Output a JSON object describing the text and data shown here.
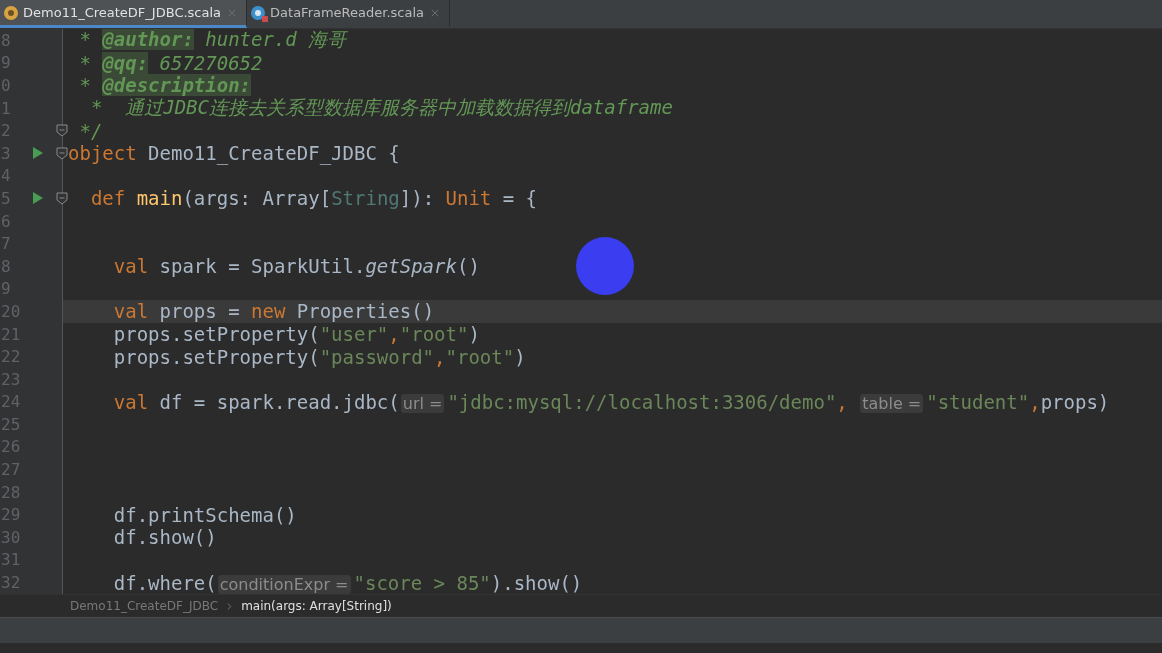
{
  "tabs": [
    {
      "label": "Demo11_CreateDF_JDBC.scala",
      "kind": "object",
      "selected": true
    },
    {
      "label": "DataFrameReader.scala",
      "kind": "class",
      "selected": false
    }
  ],
  "editor": {
    "lines": [
      {
        "number": "8",
        "run": false,
        "fold": false,
        "current": false,
        "segments": [
          {
            "kind": "comment",
            "text": " * "
          },
          {
            "kind": "doctag",
            "text": "@author:"
          },
          {
            "kind": "comment",
            "text": " hunter.d 海哥"
          }
        ]
      },
      {
        "number": "9",
        "run": false,
        "fold": false,
        "current": false,
        "segments": [
          {
            "kind": "comment",
            "text": " * "
          },
          {
            "kind": "doctag",
            "text": "@qq:"
          },
          {
            "kind": "comment",
            "text": " 657270652"
          }
        ]
      },
      {
        "number": "0",
        "run": false,
        "fold": false,
        "current": false,
        "segments": [
          {
            "kind": "comment",
            "text": " * "
          },
          {
            "kind": "doctag",
            "text": "@description:"
          }
        ]
      },
      {
        "number": "1",
        "run": false,
        "fold": false,
        "current": false,
        "segments": [
          {
            "kind": "comment",
            "text": "  *  通过JDBC连接去关系型数据库服务器中加载数据得到dataframe"
          }
        ]
      },
      {
        "number": "2",
        "run": false,
        "fold": true,
        "current": false,
        "segments": [
          {
            "kind": "comment",
            "text": " */"
          }
        ]
      },
      {
        "number": "3",
        "run": true,
        "fold": true,
        "current": false,
        "segments": [
          {
            "kind": "keyword",
            "text": "object "
          },
          {
            "kind": "plain",
            "text": "Demo11_CreateDF_JDBC {"
          }
        ]
      },
      {
        "number": "4",
        "run": false,
        "fold": false,
        "current": false
      },
      {
        "number": "5",
        "run": true,
        "fold": true,
        "current": false,
        "segments": [
          {
            "kind": "keyword",
            "text": "  def "
          },
          {
            "kind": "method",
            "text": "main"
          },
          {
            "kind": "plain",
            "text": "(args: Array["
          },
          {
            "kind": "typeparam",
            "text": "String"
          },
          {
            "kind": "plain",
            "text": "]): "
          },
          {
            "kind": "keyword",
            "text": "Unit"
          },
          {
            "kind": "plain",
            "text": " = {"
          }
        ]
      },
      {
        "number": "6",
        "run": false,
        "fold": false,
        "current": false
      },
      {
        "number": "7",
        "run": false,
        "fold": false,
        "current": false
      },
      {
        "number": "8",
        "run": false,
        "fold": false,
        "current": false,
        "segments": [
          {
            "kind": "keyword",
            "text": "    val "
          },
          {
            "kind": "plain",
            "text": "spark = SparkUtil."
          },
          {
            "kind": "italic",
            "text": "getSpark"
          },
          {
            "kind": "plain",
            "text": "()"
          }
        ]
      },
      {
        "number": "9",
        "run": false,
        "fold": false,
        "current": false
      },
      {
        "number": "20",
        "run": false,
        "fold": false,
        "current": true,
        "segments": [
          {
            "kind": "keyword",
            "text": "    val "
          },
          {
            "kind": "plain",
            "text": "props = "
          },
          {
            "kind": "keyword",
            "text": "new "
          },
          {
            "kind": "plain",
            "text": "Properties()"
          }
        ]
      },
      {
        "number": "21",
        "run": false,
        "fold": false,
        "current": false,
        "segments": [
          {
            "kind": "plain",
            "text": "    props.setProperty("
          },
          {
            "kind": "string",
            "text": "\"user\""
          },
          {
            "kind": "keyword",
            "text": ","
          },
          {
            "kind": "string",
            "text": "\"root\""
          },
          {
            "kind": "plain",
            "text": ")"
          }
        ]
      },
      {
        "number": "22",
        "run": false,
        "fold": false,
        "current": false,
        "segments": [
          {
            "kind": "plain",
            "text": "    props.setProperty("
          },
          {
            "kind": "string",
            "text": "\"password\""
          },
          {
            "kind": "keyword",
            "text": ","
          },
          {
            "kind": "string",
            "text": "\"root\""
          },
          {
            "kind": "plain",
            "text": ")"
          }
        ]
      },
      {
        "number": "23",
        "run": false,
        "fold": false,
        "current": false
      },
      {
        "number": "24",
        "run": false,
        "fold": false,
        "current": false,
        "segments": [
          {
            "kind": "keyword",
            "text": "    val "
          },
          {
            "kind": "plain",
            "text": "df = spark.read.jdbc("
          },
          {
            "kind": "hint",
            "text": "url ="
          },
          {
            "kind": "string",
            "text": "\"jdbc:mysql://localhost:3306/demo\""
          },
          {
            "kind": "keyword",
            "text": ", "
          },
          {
            "kind": "hint",
            "text": "table ="
          },
          {
            "kind": "string",
            "text": "\"student\""
          },
          {
            "kind": "keyword",
            "text": ","
          },
          {
            "kind": "plain",
            "text": "props)"
          }
        ]
      },
      {
        "number": "25",
        "run": false,
        "fold": false,
        "current": false
      },
      {
        "number": "26",
        "run": false,
        "fold": false,
        "current": false
      },
      {
        "number": "27",
        "run": false,
        "fold": false,
        "current": false
      },
      {
        "number": "28",
        "run": false,
        "fold": false,
        "current": false
      },
      {
        "number": "29",
        "run": false,
        "fold": false,
        "current": false,
        "segments": [
          {
            "kind": "plain",
            "text": "    df.printSchema()"
          }
        ]
      },
      {
        "number": "30",
        "run": false,
        "fold": false,
        "current": false,
        "segments": [
          {
            "kind": "plain",
            "text": "    df.show()"
          }
        ]
      },
      {
        "number": "31",
        "run": false,
        "fold": false,
        "current": false
      },
      {
        "number": "32",
        "run": false,
        "fold": false,
        "current": false,
        "segments": [
          {
            "kind": "plain",
            "text": "    df.where("
          },
          {
            "kind": "hint",
            "text": "conditionExpr ="
          },
          {
            "kind": "string",
            "text": "\"score > 85\""
          },
          {
            "kind": "plain",
            "text": ").show()"
          }
        ]
      }
    ]
  },
  "breadcrumb": [
    "Demo11_CreateDF_JDBC",
    "main(args: Array[String])"
  ]
}
